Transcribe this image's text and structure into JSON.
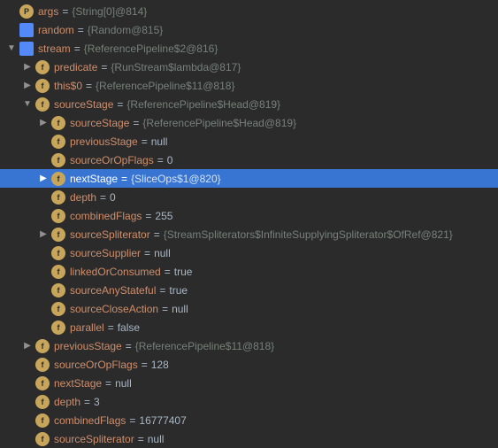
{
  "rows": [
    {
      "indent": 0,
      "arrow": "",
      "icon": "p",
      "iconText": "P",
      "name": "args",
      "valType": "obj",
      "value": "{String[0]@814}",
      "sel": false
    },
    {
      "indent": 0,
      "arrow": "",
      "icon": "s",
      "iconText": "",
      "name": "random",
      "valType": "obj",
      "value": "{Random@815}",
      "sel": false
    },
    {
      "indent": 0,
      "arrow": "down",
      "icon": "s",
      "iconText": "",
      "name": "stream",
      "valType": "obj",
      "value": "{ReferencePipeline$2@816}",
      "sel": false
    },
    {
      "indent": 1,
      "arrow": "right",
      "icon": "f",
      "iconText": "f",
      "name": "predicate",
      "valType": "obj",
      "value": "{RunStream$lambda@817}",
      "sel": false
    },
    {
      "indent": 1,
      "arrow": "right",
      "icon": "f",
      "iconText": "f",
      "name": "this$0",
      "valType": "obj",
      "value": "{ReferencePipeline$11@818}",
      "sel": false
    },
    {
      "indent": 1,
      "arrow": "down",
      "icon": "f",
      "iconText": "f",
      "name": "sourceStage",
      "valType": "obj",
      "value": "{ReferencePipeline$Head@819}",
      "sel": false
    },
    {
      "indent": 2,
      "arrow": "right",
      "icon": "f",
      "iconText": "f",
      "name": "sourceStage",
      "valType": "obj",
      "value": "{ReferencePipeline$Head@819}",
      "sel": false
    },
    {
      "indent": 2,
      "arrow": "",
      "icon": "f",
      "iconText": "f",
      "name": "previousStage",
      "valType": "lit",
      "value": "null",
      "sel": false
    },
    {
      "indent": 2,
      "arrow": "",
      "icon": "f",
      "iconText": "f",
      "name": "sourceOrOpFlags",
      "valType": "lit",
      "value": "0",
      "sel": false
    },
    {
      "indent": 2,
      "arrow": "right",
      "icon": "f",
      "iconText": "f",
      "name": "nextStage",
      "valType": "obj",
      "value": "{SliceOps$1@820}",
      "sel": true
    },
    {
      "indent": 2,
      "arrow": "",
      "icon": "f",
      "iconText": "f",
      "name": "depth",
      "valType": "lit",
      "value": "0",
      "sel": false
    },
    {
      "indent": 2,
      "arrow": "",
      "icon": "f",
      "iconText": "f",
      "name": "combinedFlags",
      "valType": "lit",
      "value": "255",
      "sel": false
    },
    {
      "indent": 2,
      "arrow": "right",
      "icon": "f",
      "iconText": "f",
      "name": "sourceSpliterator",
      "valType": "obj",
      "value": "{StreamSpliterators$InfiniteSupplyingSpliterator$OfRef@821}",
      "sel": false
    },
    {
      "indent": 2,
      "arrow": "",
      "icon": "f",
      "iconText": "f",
      "name": "sourceSupplier",
      "valType": "lit",
      "value": "null",
      "sel": false
    },
    {
      "indent": 2,
      "arrow": "",
      "icon": "f",
      "iconText": "f",
      "name": "linkedOrConsumed",
      "valType": "lit",
      "value": "true",
      "sel": false
    },
    {
      "indent": 2,
      "arrow": "",
      "icon": "f",
      "iconText": "f",
      "name": "sourceAnyStateful",
      "valType": "lit",
      "value": "true",
      "sel": false
    },
    {
      "indent": 2,
      "arrow": "",
      "icon": "f",
      "iconText": "f",
      "name": "sourceCloseAction",
      "valType": "lit",
      "value": "null",
      "sel": false
    },
    {
      "indent": 2,
      "arrow": "",
      "icon": "f",
      "iconText": "f",
      "name": "parallel",
      "valType": "lit",
      "value": "false",
      "sel": false
    },
    {
      "indent": 1,
      "arrow": "right",
      "icon": "f",
      "iconText": "f",
      "name": "previousStage",
      "valType": "obj",
      "value": "{ReferencePipeline$11@818}",
      "sel": false
    },
    {
      "indent": 1,
      "arrow": "",
      "icon": "f",
      "iconText": "f",
      "name": "sourceOrOpFlags",
      "valType": "lit",
      "value": "128",
      "sel": false
    },
    {
      "indent": 1,
      "arrow": "",
      "icon": "f",
      "iconText": "f",
      "name": "nextStage",
      "valType": "lit",
      "value": "null",
      "sel": false
    },
    {
      "indent": 1,
      "arrow": "",
      "icon": "f",
      "iconText": "f",
      "name": "depth",
      "valType": "lit",
      "value": "3",
      "sel": false
    },
    {
      "indent": 1,
      "arrow": "",
      "icon": "f",
      "iconText": "f",
      "name": "combinedFlags",
      "valType": "lit",
      "value": "16777407",
      "sel": false
    },
    {
      "indent": 1,
      "arrow": "",
      "icon": "f",
      "iconText": "f",
      "name": "sourceSpliterator",
      "valType": "lit",
      "value": "null",
      "sel": false
    }
  ],
  "eq": " = "
}
